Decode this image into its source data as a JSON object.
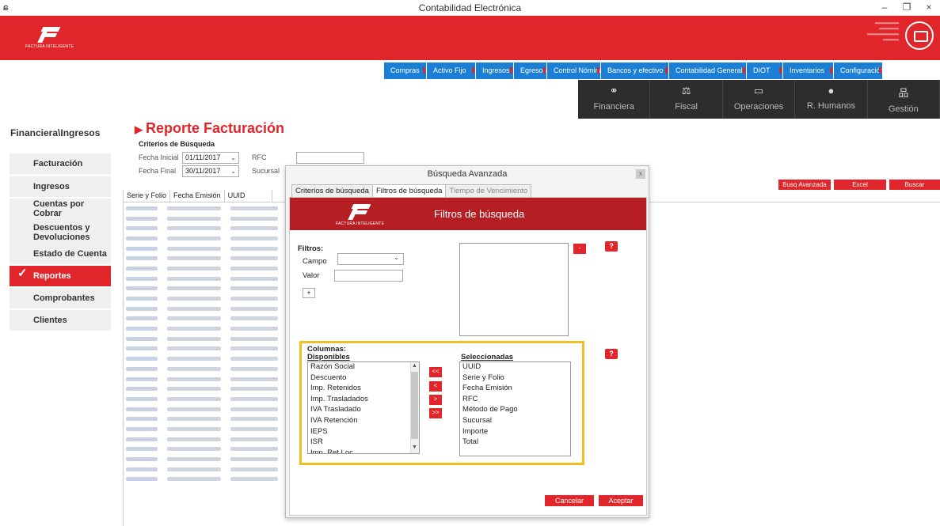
{
  "window": {
    "title": "Contabilidad Electrónica",
    "minimize": "–",
    "restore": "❐",
    "close": "×"
  },
  "brand": {
    "name": "FACTURA INTELIGENTE"
  },
  "menu": [
    {
      "label": "Compras"
    },
    {
      "label": "Activo Fijo"
    },
    {
      "label": "Ingresos"
    },
    {
      "label": "Egresos"
    },
    {
      "label": "Control Nómina"
    },
    {
      "label": "Bancos y efectivo"
    },
    {
      "label": "Contabilidad General"
    },
    {
      "label": "DIOT"
    },
    {
      "label": "Inventarios"
    },
    {
      "label": "Configuración"
    }
  ],
  "modules": [
    {
      "label": "Financiera",
      "icon": "⚭"
    },
    {
      "label": "Fiscal",
      "icon": "⚖"
    },
    {
      "label": "Operaciones",
      "icon": "▭"
    },
    {
      "label": "R. Humanos",
      "icon": "●"
    },
    {
      "label": "Gestión",
      "icon": "品"
    }
  ],
  "sidebar": {
    "title": "Financiera\\Ingresos",
    "items": [
      {
        "label": "Facturación"
      },
      {
        "label": "Ingresos"
      },
      {
        "label": "Cuentas por Cobrar"
      },
      {
        "label": "Descuentos y Devoluciones"
      },
      {
        "label": "Estado de Cuenta"
      },
      {
        "label": "Reportes"
      },
      {
        "label": "Comprobantes"
      },
      {
        "label": "Clientes"
      }
    ],
    "active": "Reportes"
  },
  "report": {
    "title": "Reporte Facturación",
    "criteria_label": "Criterios de Búsqueda",
    "fecha_inicial_label": "Fecha Inicial",
    "fecha_inicial_value": "01/11/2017",
    "fecha_final_label": "Fecha Final",
    "fecha_final_value": "30/11/2017",
    "rfc_label": "RFC",
    "sucursal_label": "Sucursal",
    "buttons": {
      "busq_avanzada": "Busq Avanzada",
      "excel": "Excel",
      "buscar": "Buscar"
    },
    "columns": [
      "Serie y Folio",
      "Fecha Emisión",
      "UUID"
    ]
  },
  "dialog": {
    "title": "Búsqueda Avanzada",
    "close": "x",
    "tabs": [
      {
        "label": "Criterios de búsqueda"
      },
      {
        "label": "Filtros de búsqueda"
      },
      {
        "label": "Tiempo de Vencimiento"
      }
    ],
    "active_tab": "Filtros de búsqueda",
    "banner_title": "Filtros de búsqueda",
    "filtros_label": "Filtros:",
    "campo_label": "Campo",
    "valor_label": "Valor",
    "add_btn": "+",
    "remove_btn": "-",
    "help": "?",
    "columnas_label": "Columnas:",
    "disponibles_label": "Disponibles",
    "seleccionadas_label": "Seleccionadas",
    "disponibles": [
      "Razón Social",
      "Descuento",
      "Imp. Retenidos",
      "Imp. Trasladados",
      "IVA Trasladado",
      "IVA Retención",
      "IEPS",
      "ISR",
      "Imp. Ret Loc"
    ],
    "seleccionadas": [
      "UUID",
      "Serie y Folio",
      "Fecha Emisión",
      "RFC",
      "Método de Pago",
      "Sucursal",
      "Importe",
      "Total"
    ],
    "move_buttons": [
      "<<",
      "<",
      ">",
      ">>"
    ],
    "cancelar": "Cancelar",
    "aceptar": "Aceptar"
  },
  "colors": {
    "brand_red": "#e0262a",
    "menu_blue": "#1b7fd6",
    "module_dark": "#2d2d2d",
    "highlight": "#f0c020"
  }
}
